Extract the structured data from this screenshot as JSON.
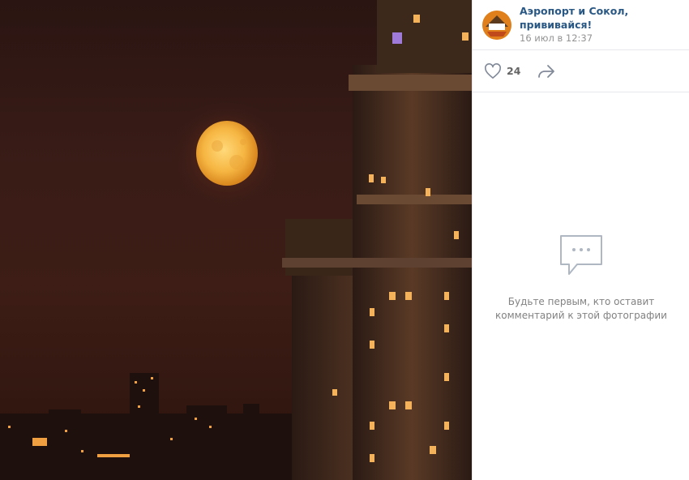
{
  "photo": {
    "alt_icon": "night-city-moon-photo"
  },
  "post": {
    "author": "Аэропорт и Сокол, прививайся!",
    "date": "16 июл в 12:37",
    "avatar_icon": "community-avatar",
    "avatar_text": "AIRPORT SOKOL",
    "likes": "24",
    "like_icon": "heart-icon",
    "share_icon": "share-arrow-icon"
  },
  "comments": {
    "empty_icon": "speech-bubble-icon",
    "empty_line1": "Будьте первым, кто оставит",
    "empty_line2": "комментарий к этой фотографии"
  },
  "colors": {
    "link": "#2a5885",
    "muted": "#939393",
    "icon": "#828a99",
    "border": "#e7e8ec"
  }
}
